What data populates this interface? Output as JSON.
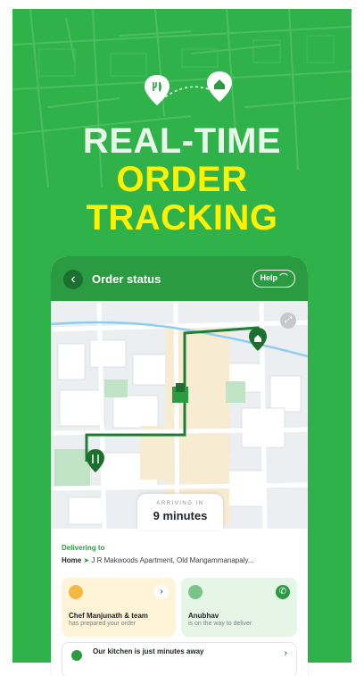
{
  "banner": {
    "headline_line1": "REAL-TIME",
    "headline_line2": "ORDER",
    "headline_line3": "TRACKING",
    "icons": [
      "restaurant-pin-icon",
      "home-pin-icon"
    ],
    "colors": {
      "background": "#2fb24a",
      "accent_yellow": "#fff200",
      "brand_green": "#2b9b42"
    }
  },
  "header": {
    "title": "Order status",
    "help_label": "Help"
  },
  "map": {
    "arriving_label": "ARRIVING IN",
    "arriving_value": "9 minutes"
  },
  "delivery": {
    "label": "Delivering to",
    "home_label": "Home",
    "address": "J R Makwoods Apartment, Old Mangammanapaly..."
  },
  "cards": {
    "chef": {
      "name": "Chef Manjunath & team",
      "status": "has prepared your order"
    },
    "rider": {
      "name": "Anubhav",
      "status": "is on the way to deliver"
    }
  },
  "kitchen": {
    "text": "Our kitchen is just minutes away"
  }
}
